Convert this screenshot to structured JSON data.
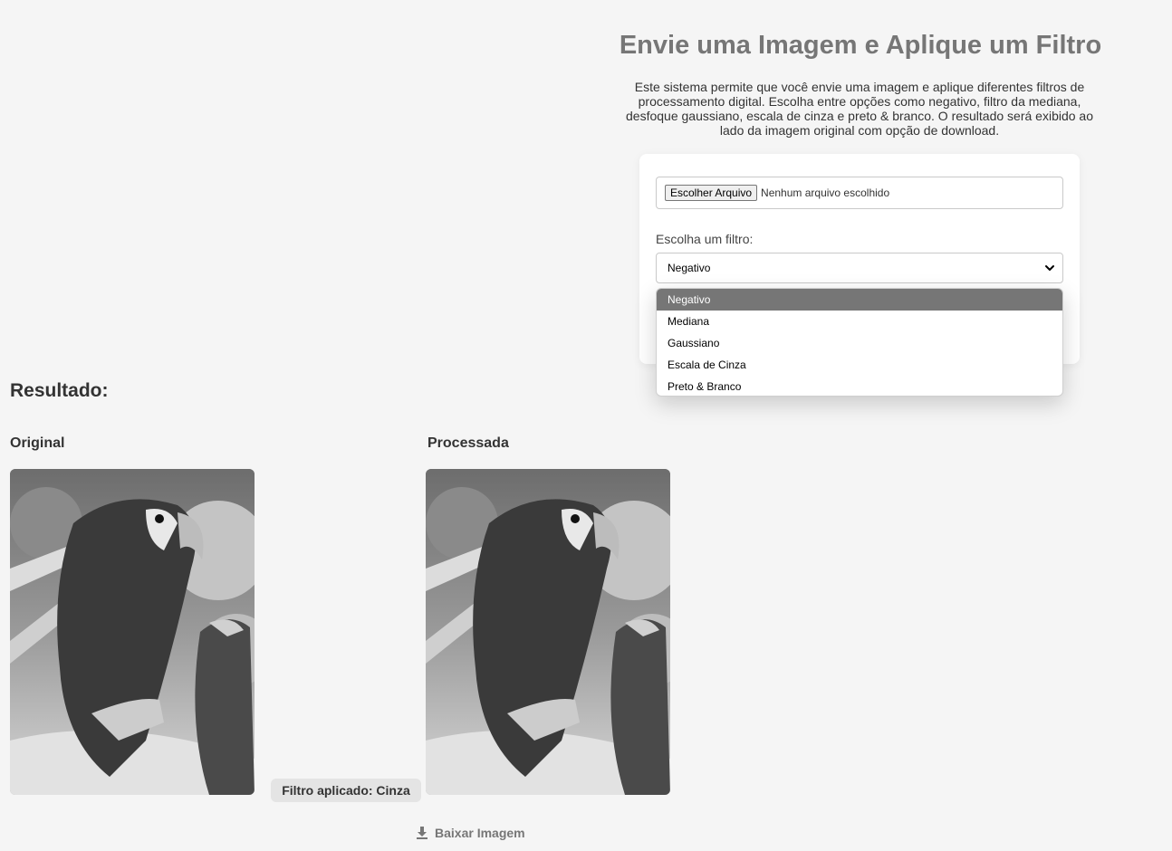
{
  "header": {
    "title": "Envie uma Imagem e Aplique um Filtro",
    "description": "Este sistema permite que você envie uma imagem e aplique diferentes filtros de processamento digital. Escolha entre opções como negativo, filtro da mediana, desfoque gaussiano, escala de cinza e preto & branco. O resultado será exibido ao lado da imagem original com opção de download."
  },
  "form": {
    "file_button_label": "Escolher Arquivo",
    "file_status": "Nenhum arquivo escolhido",
    "filter_label": "Escolha um filtro:",
    "selected_filter": "Negativo",
    "options": [
      {
        "label": "Negativo",
        "selected": true
      },
      {
        "label": "Mediana",
        "selected": false
      },
      {
        "label": "Gaussiano",
        "selected": false
      },
      {
        "label": "Escala de Cinza",
        "selected": false
      },
      {
        "label": "Preto & Branco",
        "selected": false
      }
    ]
  },
  "result": {
    "heading": "Resultado:",
    "original_label": "Original",
    "processed_label": "Processada",
    "filter_badge": "Filtro aplicado: Cinza",
    "download_label": "Baixar Imagem"
  },
  "icons": {
    "chevron": "chevron-down-icon",
    "download": "download-icon"
  },
  "colors": {
    "page_background": "#f5f5f5",
    "title": "#767676",
    "selected_option": "#767676",
    "badge_background": "#e4e4e4"
  }
}
